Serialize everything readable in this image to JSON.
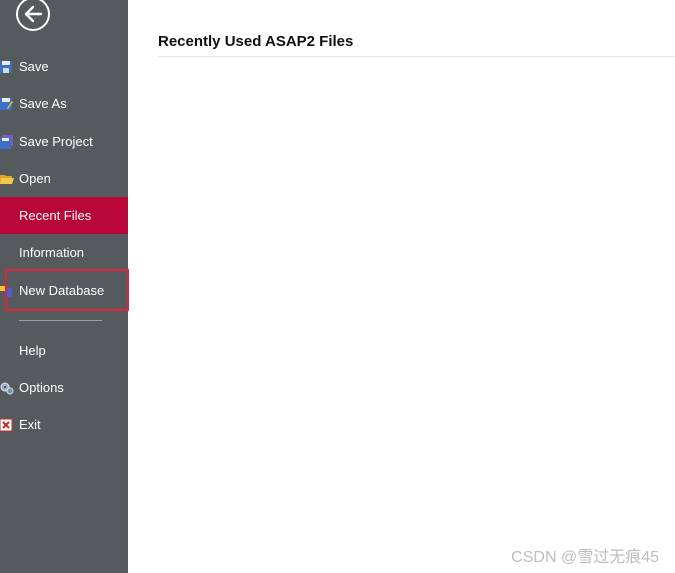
{
  "sidebar": {
    "back_icon": "back-arrow-circle-icon",
    "items": [
      {
        "label": "Save",
        "icon": "floppy-disk-icon"
      },
      {
        "label": "Save As",
        "icon": "floppy-disk-pencil-icon"
      },
      {
        "label": "Save Project",
        "icon": "floppy-disk-stack-icon"
      },
      {
        "label": "Open",
        "icon": "open-folder-icon"
      },
      {
        "label": "Recent Files",
        "active": true
      },
      {
        "label": "Information"
      },
      {
        "label": "New Database",
        "icon": "new-database-icon",
        "highlighted": true
      },
      {
        "label": "Help"
      },
      {
        "label": "Options",
        "icon": "gears-icon"
      },
      {
        "label": "Exit",
        "icon": "exit-x-icon"
      }
    ]
  },
  "main": {
    "title": "Recently Used ASAP2 Files"
  },
  "watermark": "CSDN @雪过无痕45",
  "colors": {
    "sidebar_bg": "#555a5d",
    "active_bg": "#b8063a",
    "highlight_border": "#e0213a"
  }
}
